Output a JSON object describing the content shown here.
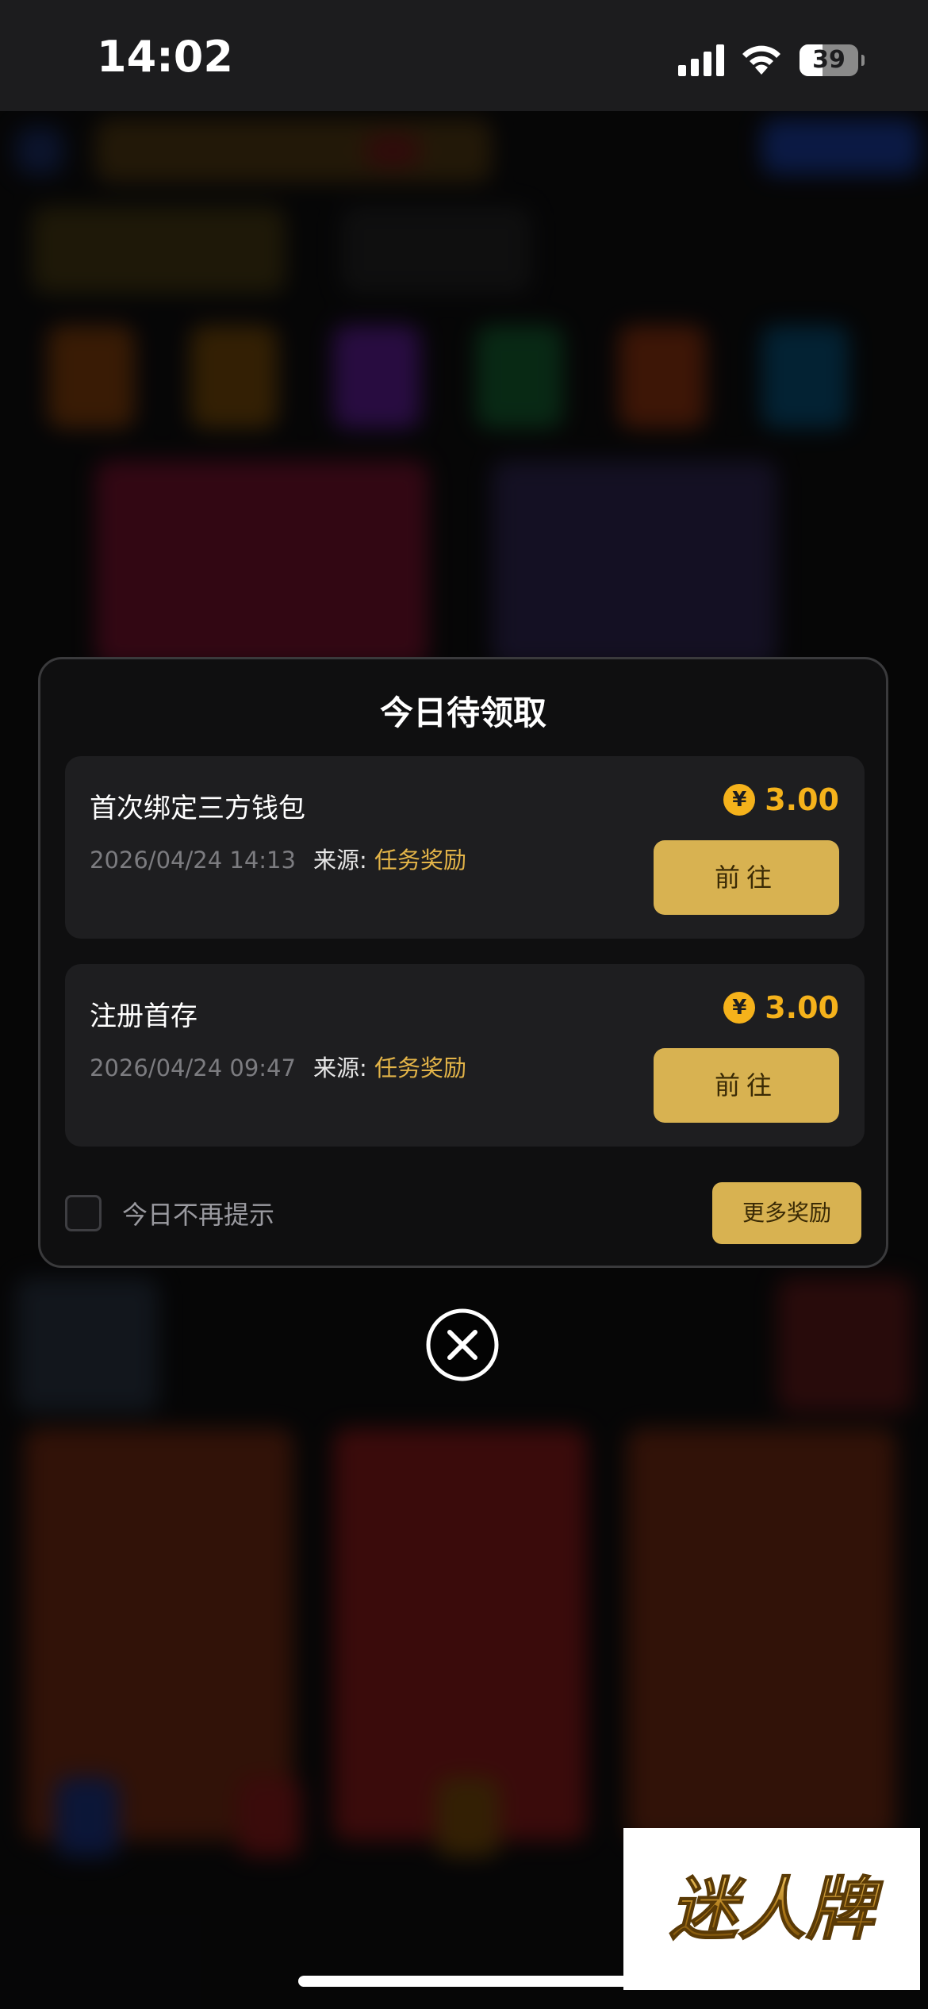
{
  "status_bar": {
    "time": "14:02",
    "battery_level": "39",
    "battery_fraction": 0.39,
    "icons": [
      "cellular-signal-icon",
      "wifi-icon",
      "battery-icon"
    ]
  },
  "modal": {
    "title": "今日待领取",
    "rewards": [
      {
        "title": "首次绑定三方钱包",
        "datetime": "2026/04/24 14:13",
        "source_label": "来源:",
        "source_value": "任务奖励",
        "currency_symbol": "¥",
        "amount": "3.00",
        "button_label": "前往"
      },
      {
        "title": "注册首存",
        "datetime": "2026/04/24 09:47",
        "source_label": "来源:",
        "source_value": "任务奖励",
        "currency_symbol": "¥",
        "amount": "3.00",
        "button_label": "前往"
      }
    ],
    "dont_show_label": "今日不再提示",
    "dont_show_checked": false,
    "more_button_label": "更多奖励"
  },
  "watermark": {
    "text": "迷人牌"
  },
  "colors": {
    "accent_gold": "#d8b251",
    "amount_orange": "#f5b21b",
    "source_gold": "#e3b448",
    "modal_bg": "#0f0f10",
    "card_bg": "#1e1e20"
  }
}
